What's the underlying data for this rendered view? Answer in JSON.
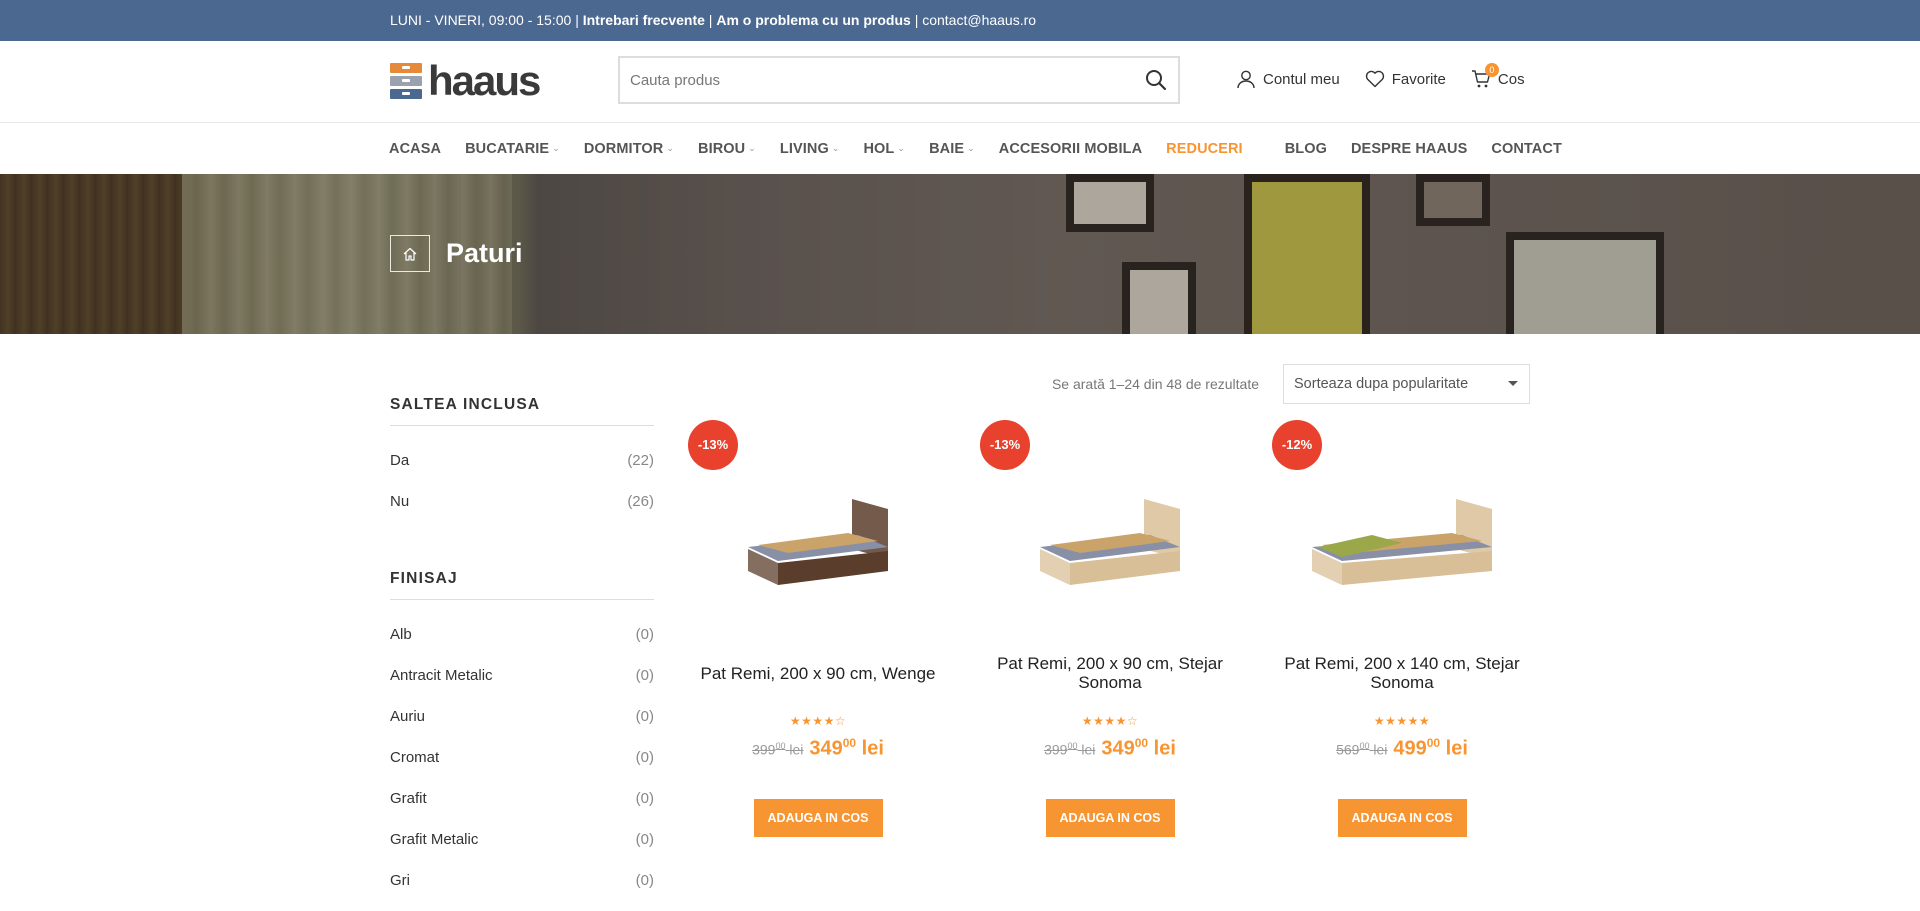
{
  "topbar": {
    "hours": "LUNI - VINERI, 09:00 - 15:00",
    "faq": "Intrebari frecvente",
    "problem": "Am o problema cu un produs",
    "email": "contact@haaus.ro",
    "sep": "|"
  },
  "logo": {
    "text": "haaus",
    "colors": [
      "#e58a3a",
      "#9aa2ad",
      "#4b6890"
    ]
  },
  "search": {
    "placeholder": "Cauta produs",
    "icon": "search-icon"
  },
  "header_links": {
    "account": "Contul meu",
    "favorites": "Favorite",
    "cart": "Cos",
    "cart_count": "0"
  },
  "nav": [
    {
      "label": "ACASA",
      "dropdown": false
    },
    {
      "label": "BUCATARIE",
      "dropdown": true
    },
    {
      "label": "DORMITOR",
      "dropdown": true
    },
    {
      "label": "BIROU",
      "dropdown": true
    },
    {
      "label": "LIVING",
      "dropdown": true
    },
    {
      "label": "HOL",
      "dropdown": true
    },
    {
      "label": "BAIE",
      "dropdown": true
    },
    {
      "label": "ACCESORII MOBILA",
      "dropdown": false
    },
    {
      "label": "REDUCERI",
      "dropdown": false,
      "accent": true
    },
    {
      "label": "BLOG",
      "dropdown": false
    },
    {
      "label": "DESPRE HAAUS",
      "dropdown": false
    },
    {
      "label": "CONTACT",
      "dropdown": false
    }
  ],
  "banner": {
    "title": "Paturi",
    "home_icon": "home-icon"
  },
  "filters": [
    {
      "title": "SALTEA INCLUSA",
      "items": [
        {
          "label": "Da",
          "count": "(22)"
        },
        {
          "label": "Nu",
          "count": "(26)"
        }
      ]
    },
    {
      "title": "FINISAJ",
      "items": [
        {
          "label": "Alb",
          "count": "(0)"
        },
        {
          "label": "Antracit Metalic",
          "count": "(0)"
        },
        {
          "label": "Auriu",
          "count": "(0)"
        },
        {
          "label": "Cromat",
          "count": "(0)"
        },
        {
          "label": "Grafit",
          "count": "(0)"
        },
        {
          "label": "Grafit Metalic",
          "count": "(0)"
        },
        {
          "label": "Gri",
          "count": "(0)"
        }
      ]
    }
  ],
  "shop": {
    "result_count": "Se arată 1–24 din 48 de rezultate",
    "sort_selected": "Sorteaza dupa popularitate"
  },
  "products": [
    {
      "badge": "-13%",
      "title": "Pat Remi, 200 x 90 cm, Wenge",
      "rating": 4,
      "old_price": "399",
      "old_dec": "00",
      "new_price": "349",
      "new_dec": "00",
      "currency": "lei",
      "button": "ADAUGA IN COS",
      "finish": "#5a3d2b"
    },
    {
      "badge": "-13%",
      "title": "Pat Remi, 200 x 90 cm, Stejar Sonoma",
      "rating": 4,
      "old_price": "399",
      "old_dec": "00",
      "new_price": "349",
      "new_dec": "00",
      "currency": "lei",
      "button": "ADAUGA IN COS",
      "finish": "#d9bf98"
    },
    {
      "badge": "-12%",
      "title": "Pat Remi, 200 x 140 cm, Stejar Sonoma",
      "rating": 4.5,
      "old_price": "569",
      "old_dec": "00",
      "new_price": "499",
      "new_dec": "00",
      "currency": "lei",
      "button": "ADAUGA IN COS",
      "finish": "#d9bf98"
    }
  ],
  "colors": {
    "primary": "#4b6890",
    "accent": "#f79532",
    "sale": "#e8412e"
  }
}
